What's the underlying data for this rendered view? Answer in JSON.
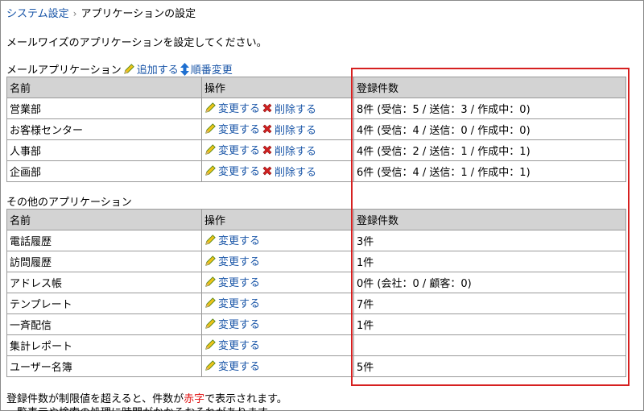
{
  "breadcrumb": {
    "parent": "システム設定",
    "current": "アプリケーションの設定"
  },
  "intro": "メールワイズのアプリケーションを設定してください。",
  "mail_section": {
    "title": "メールアプリケーション",
    "add_label": "追加する",
    "order_label": "順番変更",
    "headers": [
      "名前",
      "操作",
      "登録件数"
    ],
    "rows": [
      {
        "name": "営業部",
        "edit": "変更する",
        "delete": "削除する",
        "count": "8件 (受信：5 / 送信：3 / 作成中：0)"
      },
      {
        "name": "お客様センター",
        "edit": "変更する",
        "delete": "削除する",
        "count": "4件 (受信：4 / 送信：0 / 作成中：0)"
      },
      {
        "name": "人事部",
        "edit": "変更する",
        "delete": "削除する",
        "count": "4件 (受信：2 / 送信：1 / 作成中：1)"
      },
      {
        "name": "企画部",
        "edit": "変更する",
        "delete": "削除する",
        "count": "6件 (受信：4 / 送信：1 / 作成中：1)"
      }
    ]
  },
  "other_section": {
    "title": "その他のアプリケーション",
    "headers": [
      "名前",
      "操作",
      "登録件数"
    ],
    "rows": [
      {
        "name": "電話履歴",
        "edit": "変更する",
        "count": "3件"
      },
      {
        "name": "訪問履歴",
        "edit": "変更する",
        "count": "1件"
      },
      {
        "name": "アドレス帳",
        "edit": "変更する",
        "count": "0件 (会社：0 / 顧客：0)"
      },
      {
        "name": "テンプレート",
        "edit": "変更する",
        "count": "7件"
      },
      {
        "name": "一斉配信",
        "edit": "変更する",
        "count": "1件"
      },
      {
        "name": "集計レポート",
        "edit": "変更する",
        "count": ""
      },
      {
        "name": "ユーザー名簿",
        "edit": "変更する",
        "count": "5件"
      }
    ]
  },
  "footer": {
    "line1_before": "登録件数が制限値を超えると、件数が",
    "line1_red": "赤字",
    "line1_after": "で表示されます。",
    "line2": "一覧表示や検索の処理に時間がかかるおそれがあります。"
  },
  "colors": {
    "link": "#1a56a8",
    "header_bg": "#d3d3d3",
    "highlight": "#d62020",
    "warning_text": "#e01010"
  }
}
